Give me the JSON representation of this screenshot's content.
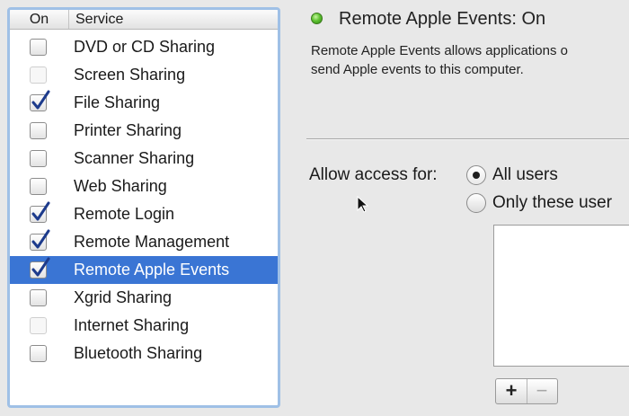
{
  "list": {
    "header_on": "On",
    "header_service": "Service",
    "services": [
      {
        "label": "DVD or CD Sharing",
        "checked": false,
        "disabled": false,
        "selected": false
      },
      {
        "label": "Screen Sharing",
        "checked": false,
        "disabled": true,
        "selected": false
      },
      {
        "label": "File Sharing",
        "checked": true,
        "disabled": false,
        "selected": false
      },
      {
        "label": "Printer Sharing",
        "checked": false,
        "disabled": false,
        "selected": false
      },
      {
        "label": "Scanner Sharing",
        "checked": false,
        "disabled": false,
        "selected": false
      },
      {
        "label": "Web Sharing",
        "checked": false,
        "disabled": false,
        "selected": false
      },
      {
        "label": "Remote Login",
        "checked": true,
        "disabled": false,
        "selected": false
      },
      {
        "label": "Remote Management",
        "checked": true,
        "disabled": false,
        "selected": false
      },
      {
        "label": "Remote Apple Events",
        "checked": true,
        "disabled": false,
        "selected": true
      },
      {
        "label": "Xgrid Sharing",
        "checked": false,
        "disabled": false,
        "selected": false
      },
      {
        "label": "Internet Sharing",
        "checked": false,
        "disabled": true,
        "selected": false
      },
      {
        "label": "Bluetooth Sharing",
        "checked": false,
        "disabled": false,
        "selected": false
      }
    ]
  },
  "status": {
    "title": "Remote Apple Events: On",
    "indicator_color": "#5fc232",
    "description_line1": "Remote Apple Events allows applications o",
    "description_line2": "send Apple events to this computer."
  },
  "access": {
    "label": "Allow access for:",
    "option_all": "All users",
    "option_only": "Only these user",
    "selected": "all"
  },
  "buttons": {
    "add": "+",
    "remove": "−"
  },
  "colors": {
    "selection": "#3a75d4",
    "list_focus_ring": "#9fc0e6"
  }
}
